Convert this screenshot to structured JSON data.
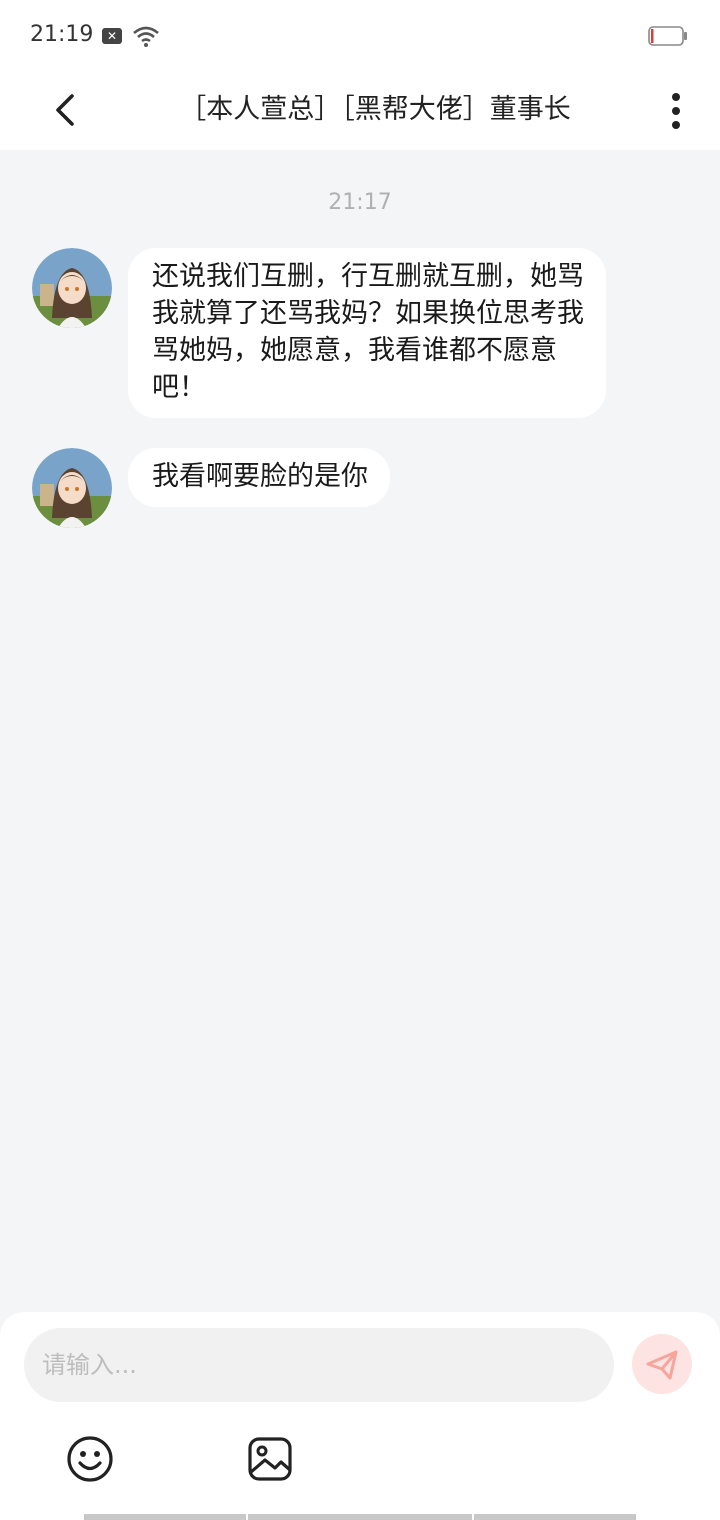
{
  "status": {
    "time": "21:19"
  },
  "header": {
    "title": "［本人萱总］［黑帮大佬］董事长"
  },
  "chat": {
    "timestamp": "21:17",
    "messages": [
      {
        "text": "还说我们互删，行互删就互删，她骂我就算了还骂我妈？如果换位思考我骂她妈，她愿意，我看谁都不愿意吧！"
      },
      {
        "text": "我看啊要脸的是你"
      }
    ]
  },
  "composer": {
    "placeholder": "请输入..."
  },
  "colors": {
    "page_bg": "#f3f5f7",
    "bubble_bg": "#ffffff",
    "send_button_bg": "#fde3e1",
    "send_icon": "#f7a59c"
  },
  "icons": [
    "back-icon",
    "more-vertical-icon",
    "send-icon",
    "emoji-icon",
    "image-icon",
    "wifi-icon",
    "battery-icon"
  ]
}
